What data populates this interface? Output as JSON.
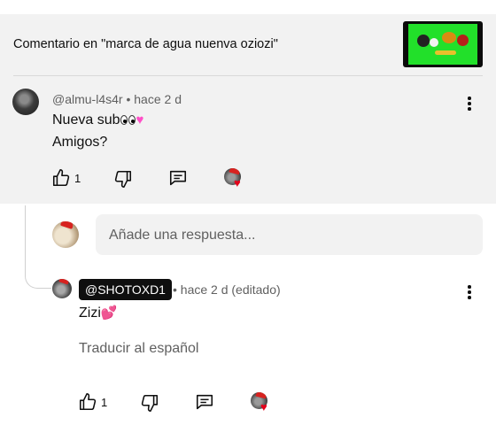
{
  "header": {
    "title": "Comentario en \"marca de agua nuenva oziozi\""
  },
  "comment": {
    "author": "@almu-l4s4r",
    "separator": " • ",
    "time": "hace 2 d",
    "line1_text": "Nueva sub",
    "line2_text": "Amigos?",
    "like_count": "1",
    "icons": [
      "like-icon",
      "dislike-icon",
      "reply-icon",
      "creator-heart-icon",
      "more-options-icon"
    ]
  },
  "reply_input": {
    "placeholder": "Añade una respuesta..."
  },
  "reply": {
    "author_handle": "@SHOTOXD1",
    "meta": "• hace 2 d (editado)",
    "text": "Zizi",
    "translate_label": "Traducir al español",
    "like_count": "1"
  },
  "colors": {
    "background": "#ffffff",
    "highlight_background": "#f2f2f2",
    "secondary_text": "#606060",
    "heart": "#e3001b",
    "handle_badge": "#0f0f0f"
  }
}
